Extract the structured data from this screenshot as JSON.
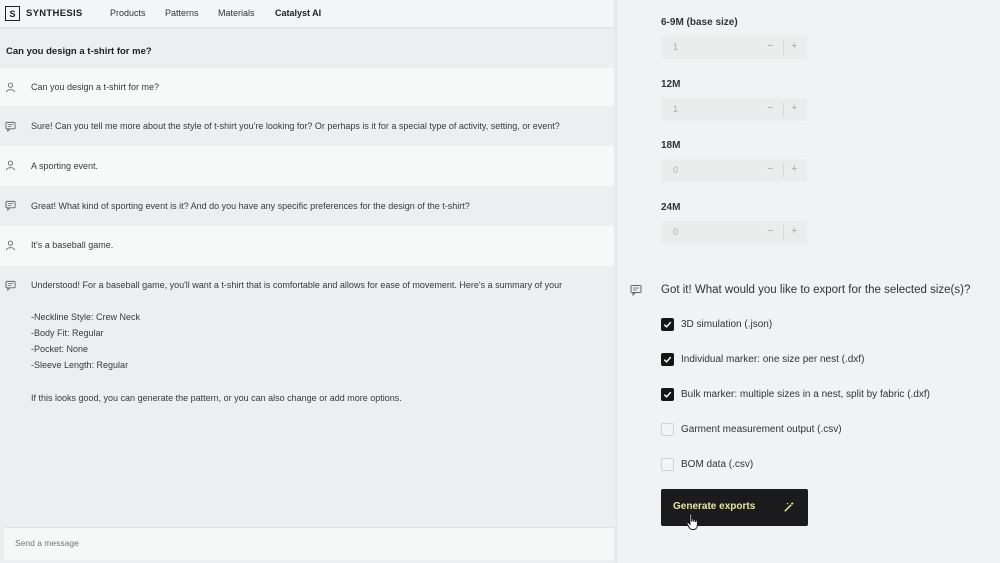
{
  "nav": {
    "logo": "S",
    "brand": "SYNTHESIS",
    "links": [
      "Products",
      "Patterns",
      "Materials",
      "Catalyst AI"
    ]
  },
  "chat": {
    "title": "Can you design a t-shirt for me?",
    "messages": [
      {
        "role": "user",
        "icon": "user-icon",
        "text": "Can you design a t-shirt for me?"
      },
      {
        "role": "assistant",
        "icon": "chat-icon",
        "text": "Sure! Can you tell me more about the style of t-shirt you're looking for? Or perhaps is it for a special type of activity, setting, or event?"
      },
      {
        "role": "user",
        "icon": "user-icon",
        "text": "A sporting event."
      },
      {
        "role": "assistant",
        "icon": "chat-icon",
        "text": "Great! What kind of sporting event is it? And do you have any specific preferences for the design of the t-shirt?"
      },
      {
        "role": "user",
        "icon": "user-icon",
        "text": "It's a baseball game."
      },
      {
        "role": "assistant",
        "icon": "chat-icon",
        "intro": "Understood! For a baseball game, you'll want a t-shirt that is comfortable and allows for ease of movement. Here's a summary of your",
        "summary": [
          "-Neckline Style: Crew Neck",
          "-Body Fit: Regular",
          "-Pocket: None",
          "-Sleeve Length: Regular"
        ],
        "outro": "If this looks good, you can generate the pattern, or you can also change or add more options."
      }
    ],
    "composer_placeholder": "Send a message"
  },
  "sizes": [
    {
      "label": "6-9M (base size)",
      "value": "1"
    },
    {
      "label": "12M",
      "value": "1"
    },
    {
      "label": "18M",
      "value": "0"
    },
    {
      "label": "24M",
      "value": "0"
    }
  ],
  "stepper_symbols": {
    "minus": "−",
    "plus": "+"
  },
  "export": {
    "icon": "chat-icon",
    "question": "Got it! What would you like to export for the selected size(s)?",
    "options": [
      {
        "label": "3D simulation (.json)",
        "checked": true
      },
      {
        "label": "Individual marker: one size per nest (.dxf)",
        "checked": true
      },
      {
        "label": "Bulk marker: multiple sizes in a nest, split by fabric (.dxf)",
        "checked": true
      },
      {
        "label": "Garment measurement output (.csv)",
        "checked": false
      },
      {
        "label": "BOM data (.csv)",
        "checked": false
      }
    ],
    "button_label": "Generate exports",
    "button_icon": "magic-wand-icon"
  },
  "colors": {
    "button_bg": "#1b1b1d",
    "button_text": "#e6ea9a",
    "checkbox_checked": "#151515"
  }
}
